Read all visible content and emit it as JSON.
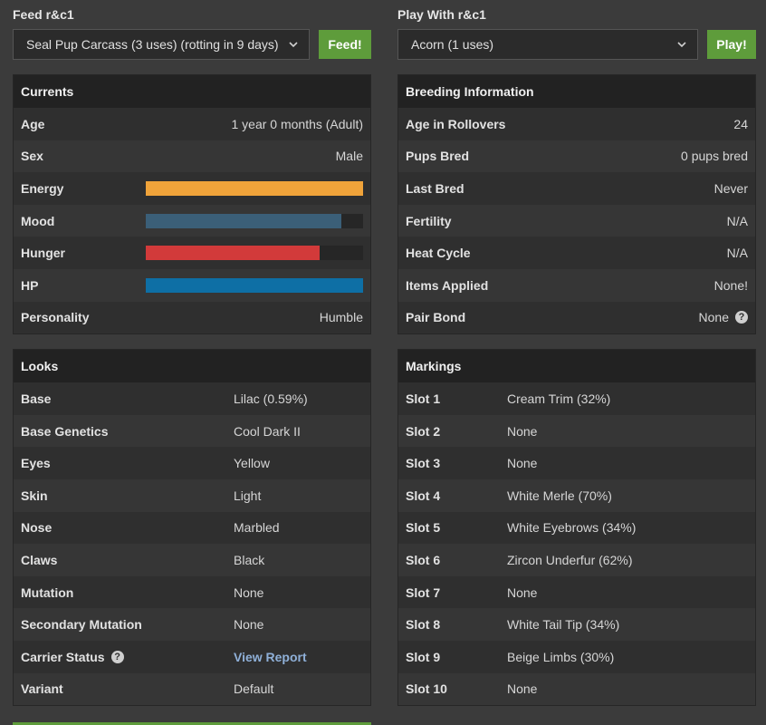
{
  "feed": {
    "title": "Feed r&c1",
    "selected": "Seal Pup Carcass (3 uses) (rotting in 9 days)",
    "button": "Feed!"
  },
  "play": {
    "title": "Play With r&c1",
    "selected": "Acorn (1 uses)",
    "button": "Play!"
  },
  "currents": {
    "title": "Currents",
    "age_label": "Age",
    "age_value": "1 year 0 months (Adult)",
    "sex_label": "Sex",
    "sex_value": "Male",
    "energy_label": "Energy",
    "energy_level": 1.0,
    "mood_label": "Mood",
    "mood_level": 0.9,
    "hunger_label": "Hunger",
    "hunger_level": 0.8,
    "hp_label": "HP",
    "hp_level": 1.0,
    "personality_label": "Personality",
    "personality_value": "Humble"
  },
  "bar_colors": {
    "energy": "#f0a33a",
    "mood": "#3b5f78",
    "hunger": "#d23a3a",
    "hp": "#0e6fa5"
  },
  "breeding": {
    "title": "Breeding Information",
    "rows": [
      {
        "label": "Age in Rollovers",
        "value": "24"
      },
      {
        "label": "Pups Bred",
        "value": "0 pups bred"
      },
      {
        "label": "Last Bred",
        "value": "Never"
      },
      {
        "label": "Fertility",
        "value": "N/A"
      },
      {
        "label": "Heat Cycle",
        "value": "N/A"
      },
      {
        "label": "Items Applied",
        "value": "None!"
      },
      {
        "label": "Pair Bond",
        "value": "None"
      }
    ]
  },
  "looks": {
    "title": "Looks",
    "rows": [
      {
        "label": "Base",
        "value": "Lilac (0.59%)"
      },
      {
        "label": "Base Genetics",
        "value": "Cool Dark II"
      },
      {
        "label": "Eyes",
        "value": "Yellow"
      },
      {
        "label": "Skin",
        "value": "Light"
      },
      {
        "label": "Nose",
        "value": "Marbled"
      },
      {
        "label": "Claws",
        "value": "Black"
      },
      {
        "label": "Mutation",
        "value": "None"
      },
      {
        "label": "Secondary Mutation",
        "value": "None"
      },
      {
        "label": "Carrier Status",
        "value": "View Report"
      },
      {
        "label": "Variant",
        "value": "Default"
      }
    ]
  },
  "markings": {
    "title": "Markings",
    "rows": [
      {
        "label": "Slot 1",
        "value": "Cream Trim (32%)"
      },
      {
        "label": "Slot 2",
        "value": "None"
      },
      {
        "label": "Slot 3",
        "value": "None"
      },
      {
        "label": "Slot 4",
        "value": "White Merle (70%)"
      },
      {
        "label": "Slot 5",
        "value": "White Eyebrows (34%)"
      },
      {
        "label": "Slot 6",
        "value": "Zircon Underfur (62%)"
      },
      {
        "label": "Slot 7",
        "value": "None"
      },
      {
        "label": "Slot 8",
        "value": "White Tail Tip (34%)"
      },
      {
        "label": "Slot 9",
        "value": "Beige Limbs (30%)"
      },
      {
        "label": "Slot 10",
        "value": "None"
      }
    ]
  },
  "help_glyph": "?"
}
